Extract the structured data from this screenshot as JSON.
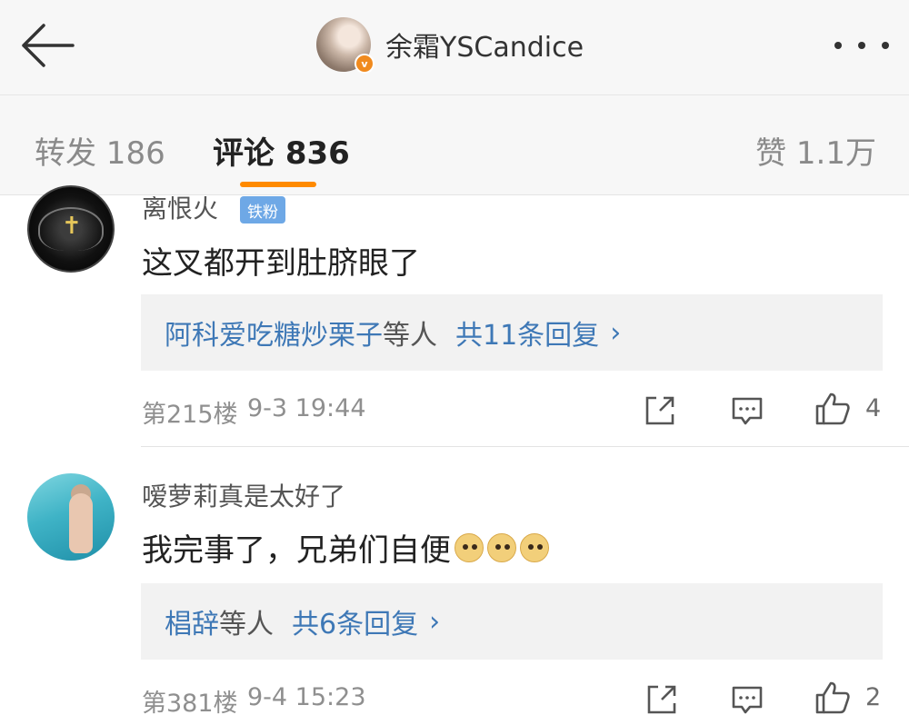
{
  "header": {
    "title": "余霜YSCandice",
    "verified_badge": "v",
    "back_icon": "arrow-left-icon",
    "more_icon": "more-dots-icon"
  },
  "tabs": {
    "repost": "转发 186",
    "comments": "评论 836",
    "likes": "赞 1.1万"
  },
  "comments": [
    {
      "username": "离恨火",
      "badge": "铁粉",
      "text": "这叉都开到肚脐眼了",
      "replies": {
        "users": "阿科爱吃糖炒栗子",
        "suffix": "等人",
        "count": "共11条回复",
        "chevron": "›"
      },
      "floor": "第215楼",
      "time": "9-3 19:44",
      "likes": "4"
    },
    {
      "username": "嗳萝莉真是太好了",
      "text": "我完事了，兄弟们自便",
      "emojis": [
        "doge-emoji",
        "doge-emoji",
        "doge-emoji"
      ],
      "replies": {
        "users": "椙辞",
        "suffix": "等人",
        "count": "共6条回复",
        "chevron": "›"
      },
      "floor": "第381楼",
      "time": "9-4 15:23",
      "likes": "2"
    }
  ],
  "colors": {
    "accent": "#ff8a00",
    "link": "#3e78b6",
    "badge": "#6ea8e6",
    "verified": "#f08a1e"
  }
}
